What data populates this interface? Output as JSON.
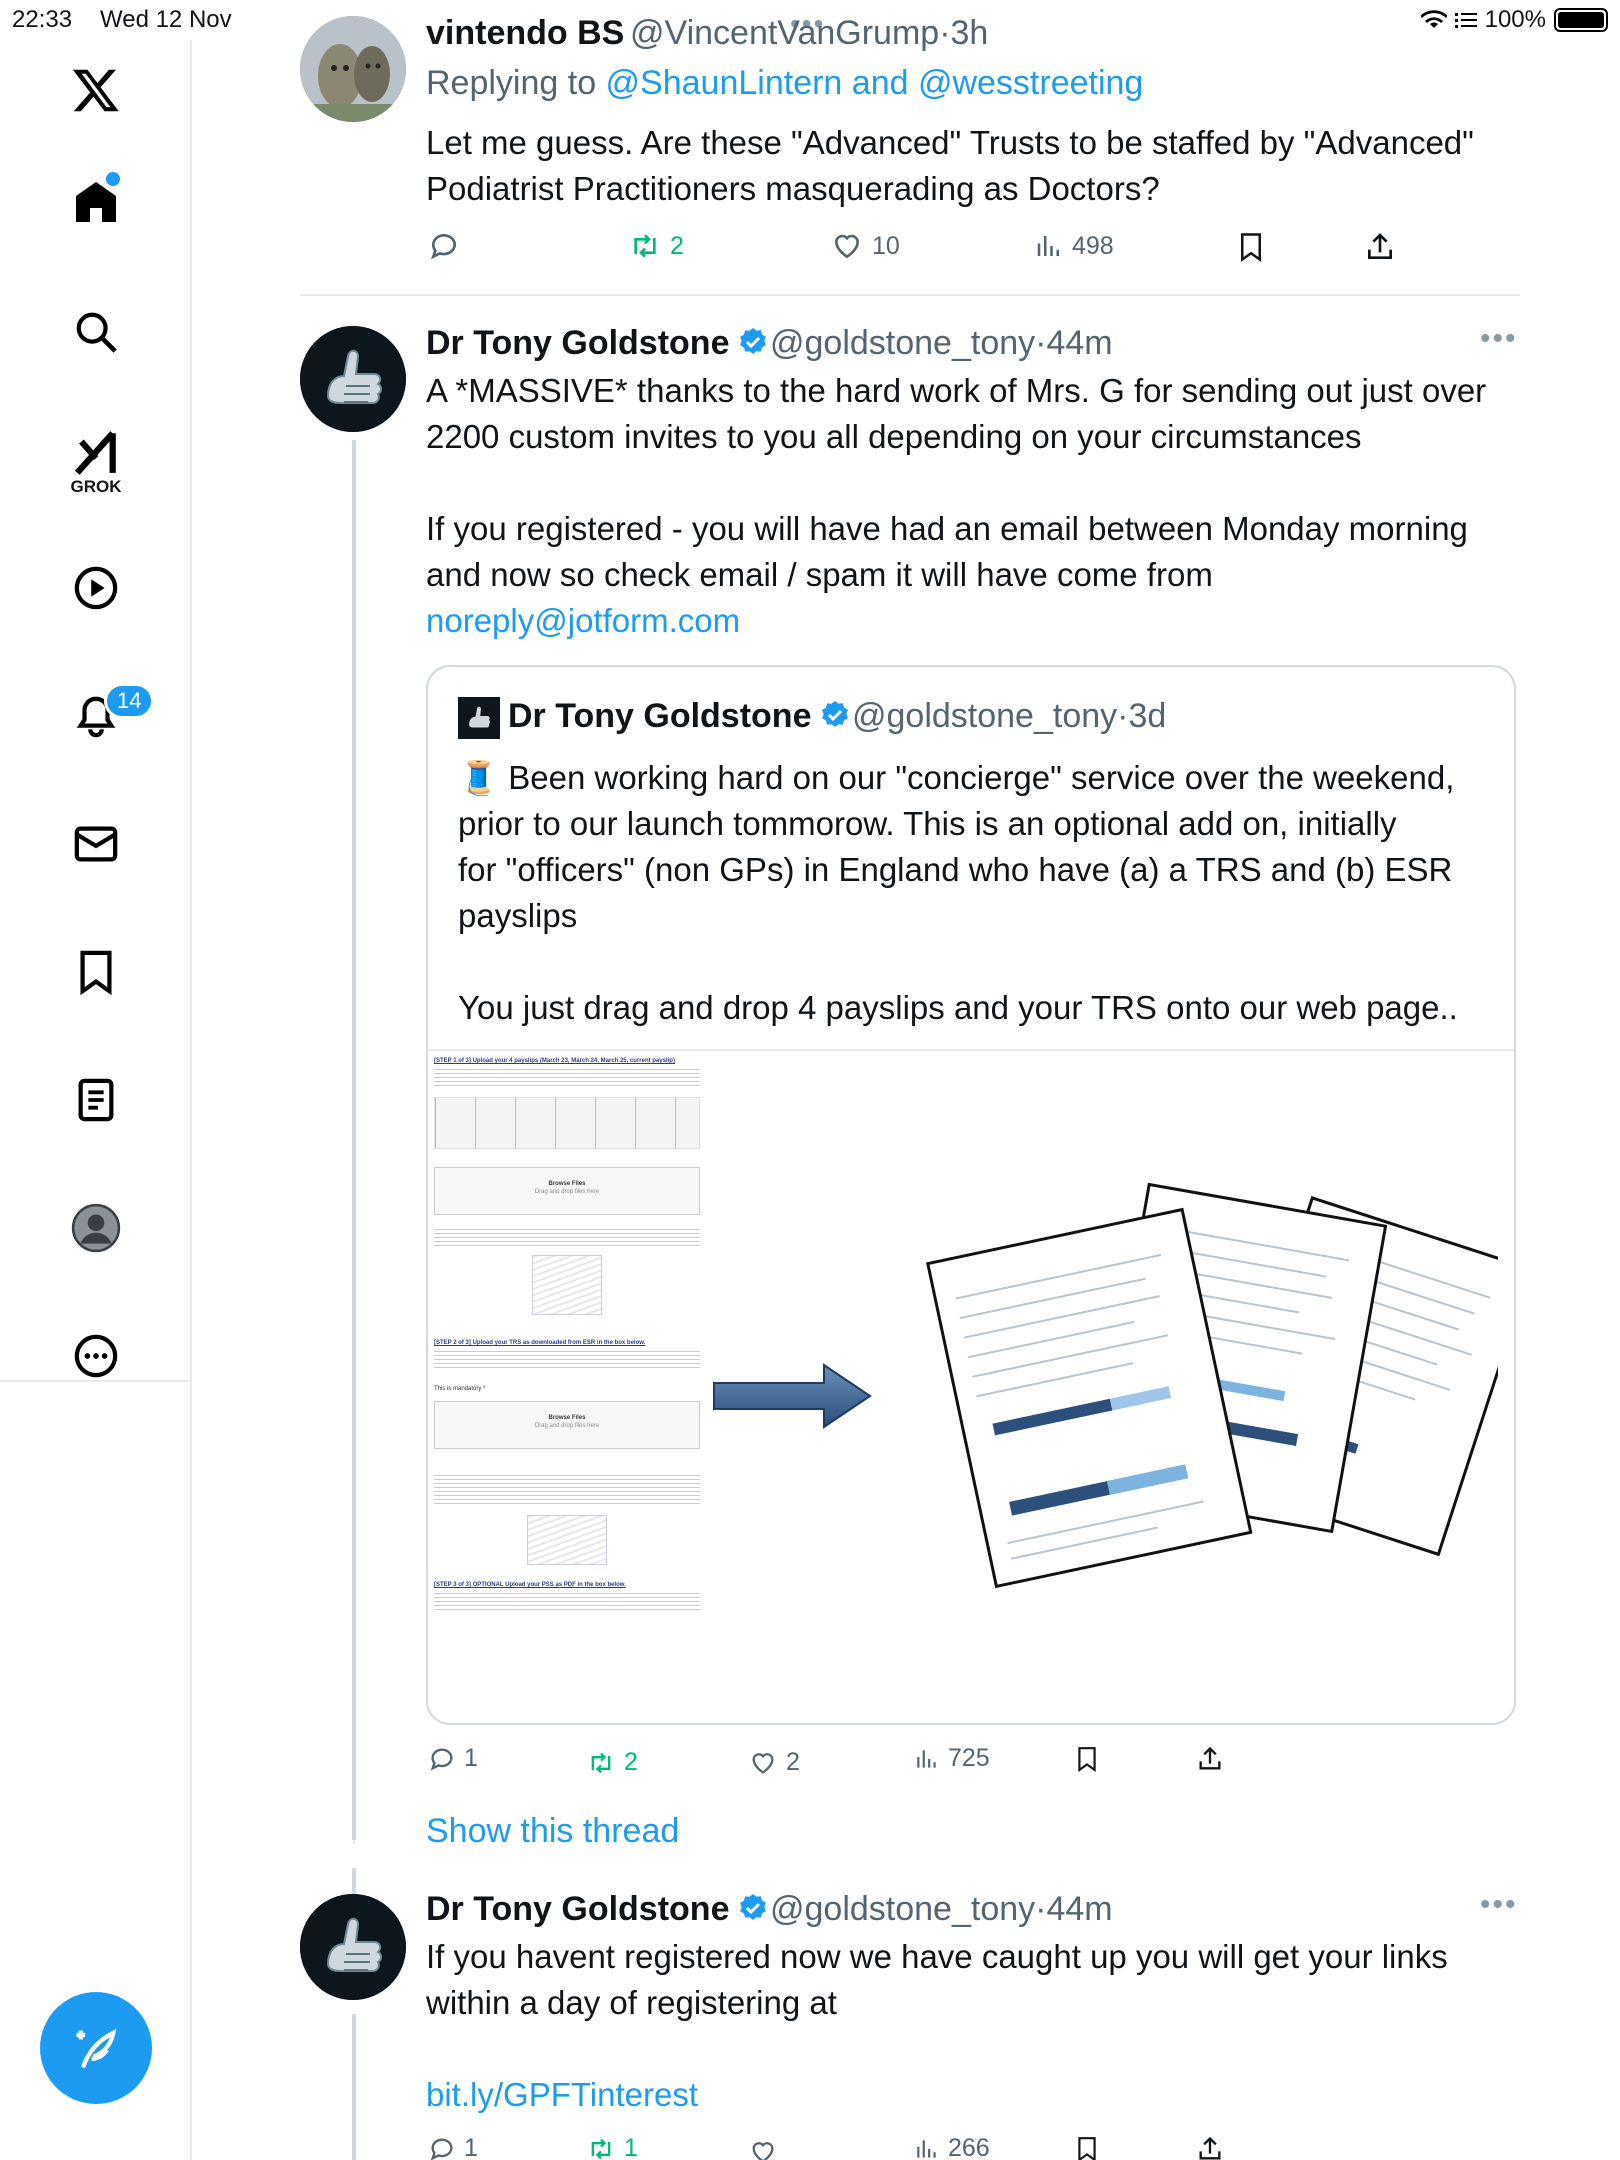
{
  "status_bar": {
    "time": "22:33",
    "date": "Wed 12 Nov",
    "battery": "100%"
  },
  "sidebar": {
    "grok_label": "GROK",
    "notifications_badge": "14",
    "items": [
      "x-logo",
      "home",
      "search",
      "grok",
      "video",
      "notifications",
      "messages",
      "bookmarks",
      "lists",
      "profile",
      "more"
    ]
  },
  "tweets": [
    {
      "name": "vintendo BS",
      "handle": "@VincentVanGrump",
      "time": "·3h",
      "replying_prefix": "Replying to ",
      "replying_to": "@ShaunLintern and @wesstreeting",
      "text_line1": "Let me guess. Are these \"Advanced\" Trusts to be staffed by \"Advanced\"",
      "text_line2": "Podiatrist Practitioners masquerading as Doctors?",
      "retweets": "2",
      "likes": "10",
      "views": "498"
    },
    {
      "name": "Dr Tony Goldstone",
      "handle": "@goldstone_tony",
      "time": "·44m",
      "text_line1": "A *MASSIVE* thanks to the hard work of Mrs. G for sending out just over",
      "text_line2": "2200 custom invites to you all depending on your circumstances",
      "text_line3": "If you registered - you will have had an email between Monday morning",
      "text_line4": "and now so check email / spam it will have come from",
      "link": "noreply@jotform.com",
      "replies": "1",
      "retweets": "2",
      "likes": "2",
      "views": "725",
      "quote": {
        "name": "Dr Tony Goldstone",
        "handle": "@goldstone_tony",
        "time": "·3d",
        "emoji": "🧵",
        "text_line1": " Been working hard on our \"concierge\" service over the weekend,",
        "text_line2": "prior to our launch tommorow. This is an optional add on, initially",
        "text_line3": "for \"officers\" (non GPs) in England who have (a) a TRS and (b) ESR",
        "text_line4": "payslips",
        "text_line5": "You just drag and drop 4 payslips and your TRS onto our web page..",
        "media": {
          "step1": "[STEP 1 of 3] Upload your 4 payslips (March 23, March 24, March 25, current payslip)",
          "step2": "[STEP 2 of 3] Upload your TRS as downloaded from ESR in the box below.",
          "step3": "[STEP 3 of 3] OPTIONAL Upload your PSS as PDF in the box below.",
          "browse": "Browse Files",
          "drag": "Drag and drop files here",
          "mandatory": "This is mandatory *"
        }
      },
      "show_thread": "Show this thread"
    },
    {
      "name": "Dr Tony Goldstone",
      "handle": "@goldstone_tony",
      "time": "·44m",
      "text_line1": "If you havent registered now we have caught up you will get your links",
      "text_line2": "within a day of registering at",
      "link": "bit.ly/GPFTinterest",
      "replies": "1",
      "retweets": "1",
      "views": "266"
    }
  ],
  "colors": {
    "accent": "#1d9bf0",
    "retweet": "#00ba7c",
    "muted": "#536471",
    "border": "#e7e9ea"
  }
}
